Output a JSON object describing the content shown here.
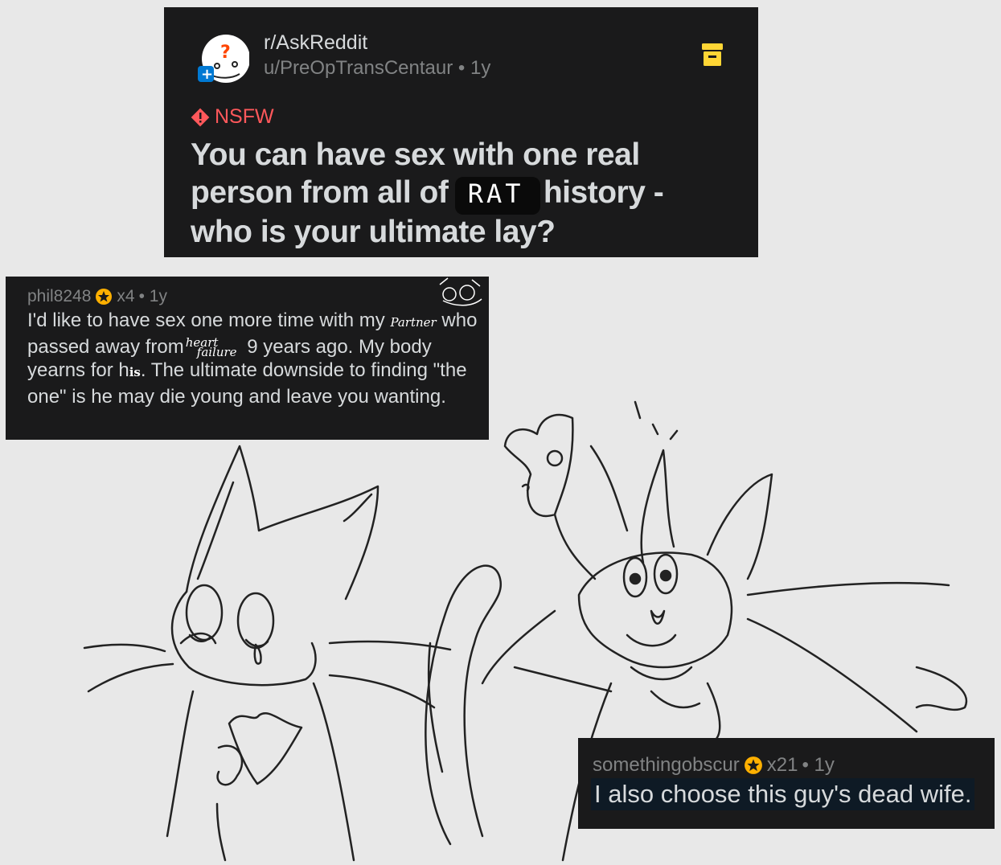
{
  "post": {
    "subreddit": "r/AskReddit",
    "username": "u/PreOpTransCentaur",
    "separator": "•",
    "age": "1y",
    "nsfw_label": "NSFW",
    "title_part1": "You can have sex with one real person from all of",
    "title_scribble": "RAT",
    "title_part2": "history - who is your ultimate lay?",
    "avatar_icon": "reddit-snoo-question-icon",
    "archive_icon": "archive-box-icon",
    "accent_nsfw": "#ff585b",
    "accent_archive": "#ffd635"
  },
  "comments": [
    {
      "username": "phil8248",
      "awards": "x4",
      "age": "• 1y",
      "body_a": "I'd like to have sex one more time with my",
      "note_partner": "Partner",
      "body_b": "who passed away from",
      "note_heart": "heart",
      "note_failure": "failure",
      "body_c": "9 years ago. My body yearns for h",
      "note_his": "is",
      "body_d": ". The ultimate downside to finding \"the one\" is",
      "body_e": "he may die young and leave you wanting."
    },
    {
      "username": "somethingobscur",
      "awards": "x21",
      "age": "• 1y",
      "body": "I also choose this guy's dead wife."
    }
  ],
  "colors": {
    "panel": "#1a1a1b",
    "background": "#e8e8e8",
    "text": "#d7dadc",
    "muted": "#818384",
    "award_gold": "#ffb000"
  }
}
